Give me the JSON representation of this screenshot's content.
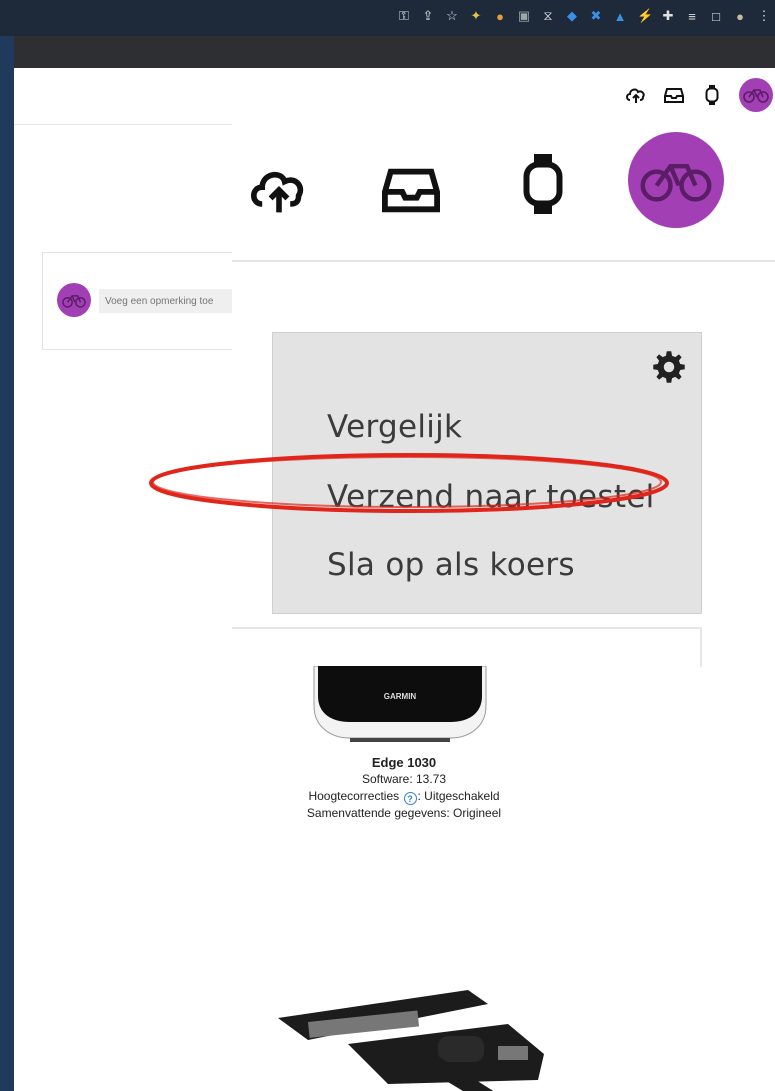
{
  "browser": {
    "extension_icons": [
      "key-icon",
      "share-icon",
      "star-icon",
      "extension-icon",
      "extension-icon",
      "extension-icon",
      "extension-icon",
      "extension-icon",
      "extension-icon",
      "extension-icon",
      "puzzle-icon",
      "playlist-icon",
      "sidepanel-icon",
      "profile-icon",
      "menu-icon"
    ]
  },
  "header": {
    "icons": [
      "upload-icon",
      "inbox-icon",
      "watch-icon",
      "avatar"
    ]
  },
  "comment": {
    "placeholder": "Voeg een opmerking toe"
  },
  "menu": {
    "items": [
      {
        "label": "Vergelijk"
      },
      {
        "label": "Verzend naar toestel"
      },
      {
        "label": "Sla op als koers"
      }
    ]
  },
  "device": {
    "brand": "GARMIN",
    "name": "Edge 1030",
    "software": "Software: 13.73",
    "elevation_label": "Hoogtecorrecties",
    "elevation_value": ": Uitgeschakeld",
    "summary": "Samenvattende gegevens: Origineel",
    "help_glyph": "?"
  },
  "colors": {
    "avatar": "#a23fb5",
    "annotation": "#e0261b",
    "menu_bg": "#e3e3e3",
    "help": "#2f7fd6"
  }
}
